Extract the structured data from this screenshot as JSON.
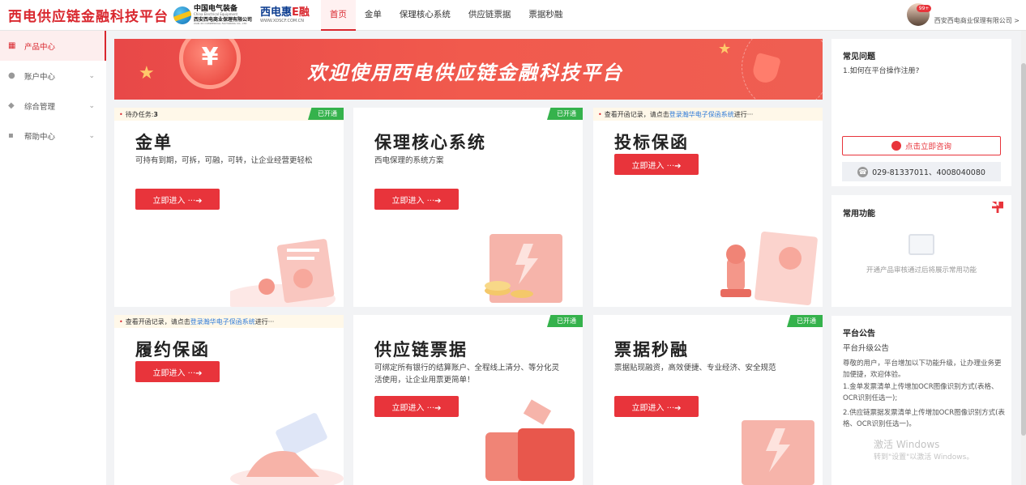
{
  "header": {
    "brand": "西电供应链金融科技平台",
    "logo_cee": {
      "line1": "中国电气装备",
      "line2": "China Electrical Equipment",
      "line3": "西安西电商业保理有限公司",
      "line4": "XIAN XD COMMERCIAL FACTORING CO., LTD"
    },
    "logo_xd": {
      "main": "西电惠",
      "accent": "E融",
      "url": "WWW.XDSCF.COM.CN"
    },
    "nav": [
      "首页",
      "金单",
      "保理核心系统",
      "供应链票据",
      "票据秒融"
    ],
    "active_nav": "首页",
    "user": {
      "badge": "99+",
      "company": "西安西电商业保理有限公司 >"
    }
  },
  "sidebar": {
    "items": [
      {
        "label": "产品中心",
        "icon": "grid-icon",
        "active": true
      },
      {
        "label": "账户中心",
        "icon": "user-icon",
        "chevron": "⌄"
      },
      {
        "label": "综合管理",
        "icon": "layers-icon",
        "chevron": "⌄"
      },
      {
        "label": "帮助中心",
        "icon": "chat-icon",
        "chevron": "⌄"
      }
    ]
  },
  "banner": {
    "title": "欢迎使用西电供应链金融科技平台",
    "coin_symbol": "¥"
  },
  "cards": [
    {
      "top_prefix": "待办任务: ",
      "top_count": "3",
      "opened": "已开通",
      "title": "金单",
      "desc": "可持有到期，可拆，可融，可转，让企业经营更轻松",
      "button": "立即进入 ···➔"
    },
    {
      "opened": "已开通",
      "title": "保理核心系统",
      "desc": "西电保理的系统方案",
      "button": "立即进入 ···➔"
    },
    {
      "top_prefix": "查看开函记录，请点击 ",
      "top_link": "登录瀚华电子保函系统",
      "top_suffix": " 进行···",
      "title": "投标保函",
      "button": "立即进入 ···➔"
    },
    {
      "top_prefix": "查看开函记录，请点击 ",
      "top_link": "登录瀚华电子保函系统",
      "top_suffix": " 进行···",
      "title": "履约保函",
      "button": "立即进入 ···➔"
    },
    {
      "opened": "已开通",
      "title": "供应链票据",
      "desc": "可绑定所有银行的结算账户、全程线上清分、等分化灵活使用，让企业用票更简单！",
      "button": "立即进入 ···➔"
    },
    {
      "opened": "已开通",
      "title": "票据秒融",
      "desc": "票据贴现融资，高效便捷、专业经济、安全规范",
      "button": "立即进入 ···➔"
    }
  ],
  "faq": {
    "title": "常见问题",
    "q1": "1.如何在平台操作注册?",
    "consult_button": "点击立即咨询",
    "phone": "029-81337011、4008040080"
  },
  "common": {
    "title": "常用功能",
    "empty_text": "开通产品审核通过后将展示常用功能"
  },
  "announcement": {
    "title": "平台公告",
    "subtitle": "平台升级公告",
    "body1": "尊敬的用户，平台增加以下功能升级，让办理业务更加便捷，欢迎体验。",
    "body2": "1.金单发票清单上传增加OCR图像识别方式(表格、OCR识别任选一);",
    "body3": "2.供应链票据发票清单上传增加OCR图像识别方式(表格、OCR识别任选一)。"
  },
  "watermark": {
    "line1": "激活 Windows",
    "line2": "转到\"设置\"以激活 Windows。"
  },
  "colors": {
    "brand_red": "#d9272e",
    "button_red": "#e8343b",
    "opened_green": "#35b24c",
    "link_blue": "#2f7bd8"
  }
}
